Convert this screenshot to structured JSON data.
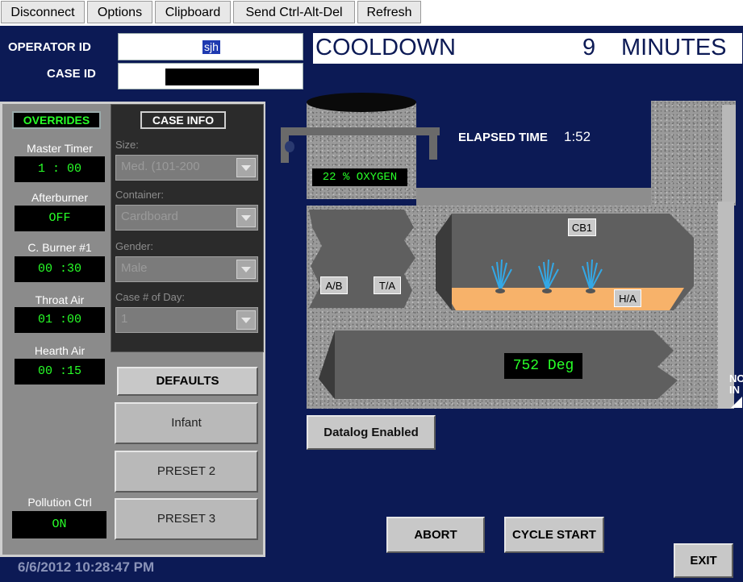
{
  "toolbar": {
    "buttons": [
      {
        "label": "Disconnect"
      },
      {
        "label": "Options"
      },
      {
        "label": "Clipboard"
      },
      {
        "label": "Send Ctrl-Alt-Del"
      },
      {
        "label": "Refresh"
      }
    ]
  },
  "operator": {
    "label": "OPERATOR ID",
    "value": "sjh"
  },
  "case": {
    "label": "CASE ID",
    "value": ""
  },
  "status": {
    "state": "COOLDOWN",
    "minutes": "9",
    "unit": "MINUTES"
  },
  "overrides": {
    "title": "OVERRIDES",
    "items": [
      {
        "label": "Master Timer",
        "value": "1 : 00"
      },
      {
        "label": "Afterburner",
        "value": "OFF"
      },
      {
        "label": "C. Burner #1",
        "value": "00 :30"
      },
      {
        "label": "Throat Air",
        "value": "01 :00"
      },
      {
        "label": "Hearth Air",
        "value": "00 :15"
      }
    ],
    "pollution": {
      "label": "Pollution Ctrl",
      "value": "ON"
    }
  },
  "case_info": {
    "title": "CASE INFO",
    "fields": [
      {
        "label": "Size:",
        "value": "Med. (101-200"
      },
      {
        "label": "Container:",
        "value": "Cardboard"
      },
      {
        "label": "Gender:",
        "value": "Male"
      },
      {
        "label": "Case # of Day:",
        "value": "1"
      }
    ]
  },
  "presets": {
    "defaults": "DEFAULTS",
    "p1": "Infant",
    "p2": "PRESET 2",
    "p3": "PRESET 3"
  },
  "furnace": {
    "oxygen": "22 % OXYGEN",
    "elapsed_label": "ELAPSED TIME",
    "elapsed_value": "1:52",
    "tags": {
      "cb1": "CB1",
      "ab": "A/B",
      "ta": "T/A",
      "ha": "H/A"
    },
    "temperature": "752  Deg",
    "side_text": "NO\nIN"
  },
  "datalog": "Datalog Enabled",
  "actions": {
    "abort": "ABORT",
    "cycle_start": "CYCLE START",
    "exit": "EXIT"
  },
  "datetime": "6/6/2012 10:28:47 PM",
  "colors": {
    "background": "#0c1a55",
    "lcd_green": "#28ff28",
    "hearth_orange": "#f7b26a",
    "flame_blue": "#33a8e6"
  }
}
